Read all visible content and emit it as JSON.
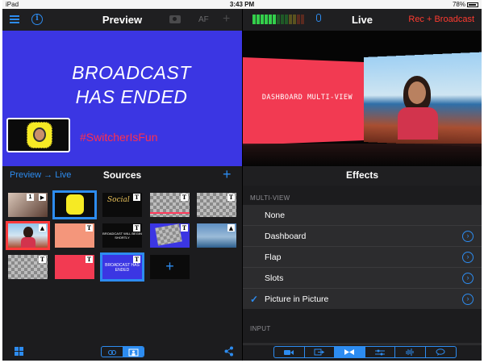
{
  "status_bar": {
    "device": "iPad",
    "time": "3:43 PM",
    "battery": "78%"
  },
  "preview": {
    "title": "Preview",
    "af_label": "AF",
    "broadcast_line1": "BROADCAST",
    "broadcast_line2": "HAS ENDED",
    "hashtag": "#SwitcherIsFun"
  },
  "sources": {
    "route_label": "Preview → Live",
    "title": "Sources",
    "thumbs": [
      {
        "kind": "video",
        "num": "1",
        "tag": "",
        "text": ""
      },
      {
        "kind": "snap",
        "num": "",
        "tag": "",
        "text": ""
      },
      {
        "kind": "title",
        "num": "",
        "tag": "T",
        "text": "Social"
      },
      {
        "kind": "checker",
        "num": "",
        "tag": "T",
        "text": ""
      },
      {
        "kind": "checker",
        "num": "",
        "tag": "T",
        "text": ""
      },
      {
        "kind": "photo",
        "num": "",
        "tag": "",
        "text": ""
      },
      {
        "kind": "peach",
        "num": "",
        "tag": "T",
        "text": ""
      },
      {
        "kind": "dark",
        "num": "",
        "tag": "T",
        "text": "BROADCAST WILL BEGIN SHORTLY"
      },
      {
        "kind": "purple",
        "num": "",
        "tag": "T",
        "text": ""
      },
      {
        "kind": "sky",
        "num": "",
        "tag": "",
        "text": ""
      },
      {
        "kind": "checker",
        "num": "",
        "tag": "T",
        "text": ""
      },
      {
        "kind": "red",
        "num": "",
        "tag": "T",
        "text": ""
      },
      {
        "kind": "blue",
        "num": "",
        "tag": "T",
        "text": "BROADCAST HAS ENDED"
      }
    ]
  },
  "live": {
    "title": "Live",
    "rec_label": "Rec + Broadcast",
    "panel_text": "DASHBOARD MULTI-VIEW"
  },
  "effects": {
    "title": "Effects",
    "group_label": "MULTI-VIEW",
    "input_label": "INPUT",
    "items": [
      {
        "label": "None",
        "checked": false,
        "has_chevron": false
      },
      {
        "label": "Dashboard",
        "checked": false,
        "has_chevron": true
      },
      {
        "label": "Flap",
        "checked": false,
        "has_chevron": true
      },
      {
        "label": "Slots",
        "checked": false,
        "has_chevron": true
      },
      {
        "label": "Picture in Picture",
        "checked": true,
        "has_chevron": true
      }
    ]
  },
  "tabbar": {
    "tabs": [
      "camera-icon",
      "output-icon",
      "multiview-icon",
      "sliders-icon",
      "audio-icon",
      "chat-icon"
    ],
    "active_index": 2
  },
  "colors": {
    "accent": "#2d8cf0",
    "rec": "#ff3b30",
    "preview_bg": "#3b36e3",
    "panel_red": "#f23a52"
  }
}
